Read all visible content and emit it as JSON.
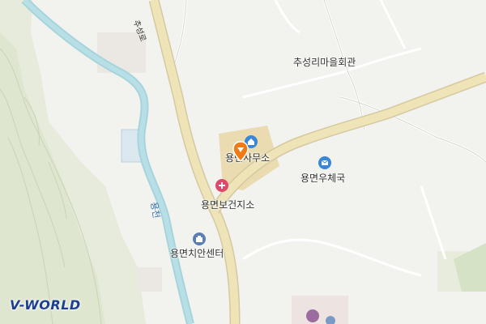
{
  "map": {
    "logo": {
      "text": "V-WORLD"
    },
    "places": [
      {
        "label": "추성리마을회관",
        "icon": "none"
      },
      {
        "label": "용면사무소",
        "icon": "house-icon",
        "color": "#3a86d8"
      },
      {
        "label": "용면우체국",
        "icon": "post-office-icon",
        "color": "#3a86d8"
      },
      {
        "label": "용면보건지소",
        "icon": "hospital-icon",
        "color": "#e0486a"
      },
      {
        "label": "용면치안센터",
        "icon": "police-icon",
        "color": "#5a7fb0"
      }
    ],
    "road_label": "추성로",
    "river_label": "용천",
    "selected_marker": {
      "color": "#f07a16"
    }
  }
}
